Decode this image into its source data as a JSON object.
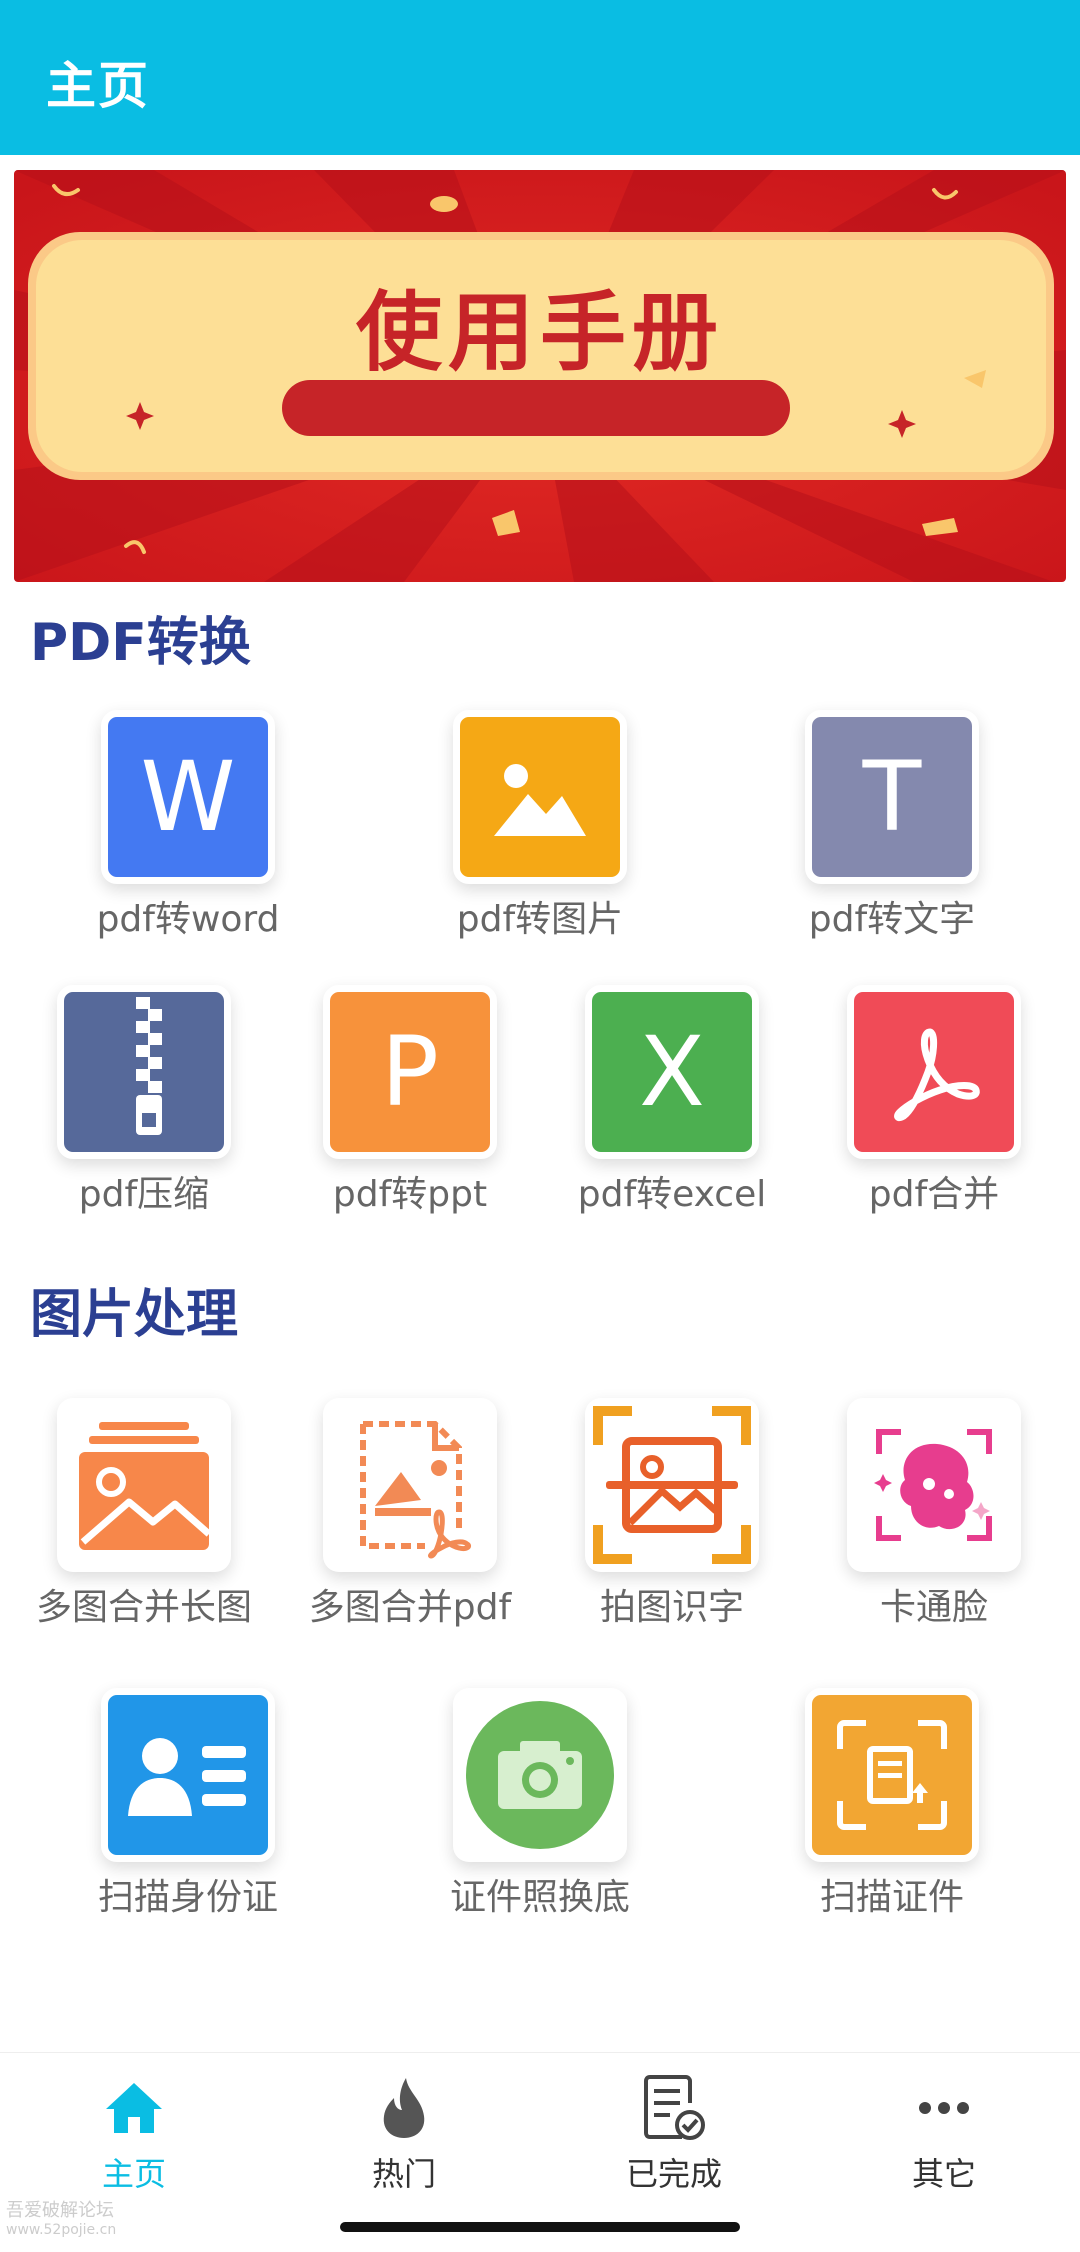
{
  "header": {
    "title": "主页"
  },
  "banner": {
    "title": "使用手册"
  },
  "sections": {
    "pdf": {
      "title": "PDF转换",
      "items": [
        {
          "label": "pdf转word",
          "icon": "word-icon",
          "letter": "W",
          "color": "#4479F2"
        },
        {
          "label": "pdf转图片",
          "icon": "image-icon",
          "color": "#F5A815"
        },
        {
          "label": "pdf转文字",
          "icon": "text-icon",
          "letter": "T",
          "color": "#8489AE"
        },
        {
          "label": "pdf压缩",
          "icon": "zip-icon",
          "color": "#56699A"
        },
        {
          "label": "pdf转ppt",
          "icon": "ppt-icon",
          "letter": "P",
          "color": "#F7923B"
        },
        {
          "label": "pdf转excel",
          "icon": "excel-icon",
          "letter": "X",
          "color": "#4CAF50"
        },
        {
          "label": "pdf合并",
          "icon": "acrobat-icon",
          "color": "#F04B57"
        }
      ]
    },
    "image": {
      "title": "图片处理",
      "items": [
        {
          "label": "多图合并长图",
          "icon": "stacked-images-icon",
          "color": "#F7874A"
        },
        {
          "label": "多图合并pdf",
          "icon": "image-to-pdf-icon",
          "color": "#F28A55"
        },
        {
          "label": "拍图识字",
          "icon": "scan-image-icon",
          "color": "#F0A020"
        },
        {
          "label": "卡通脸",
          "icon": "cartoon-face-icon",
          "color": "#E73D8E"
        },
        {
          "label": "扫描身份证",
          "icon": "id-card-icon",
          "color": "#2196E8"
        },
        {
          "label": "证件照换底",
          "icon": "camera-icon",
          "color": "#6BB85C"
        },
        {
          "label": "扫描证件",
          "icon": "scan-document-icon",
          "color": "#F2A633"
        }
      ]
    }
  },
  "nav": {
    "items": [
      {
        "label": "主页",
        "icon": "home-icon",
        "active": true
      },
      {
        "label": "热门",
        "icon": "flame-icon"
      },
      {
        "label": "已完成",
        "icon": "checklist-icon"
      },
      {
        "label": "其它",
        "icon": "more-icon"
      }
    ],
    "active_color": "#0ABDE3"
  },
  "watermark": {
    "line1": "吾爱破解论坛",
    "line2": "www.52pojie.cn"
  }
}
